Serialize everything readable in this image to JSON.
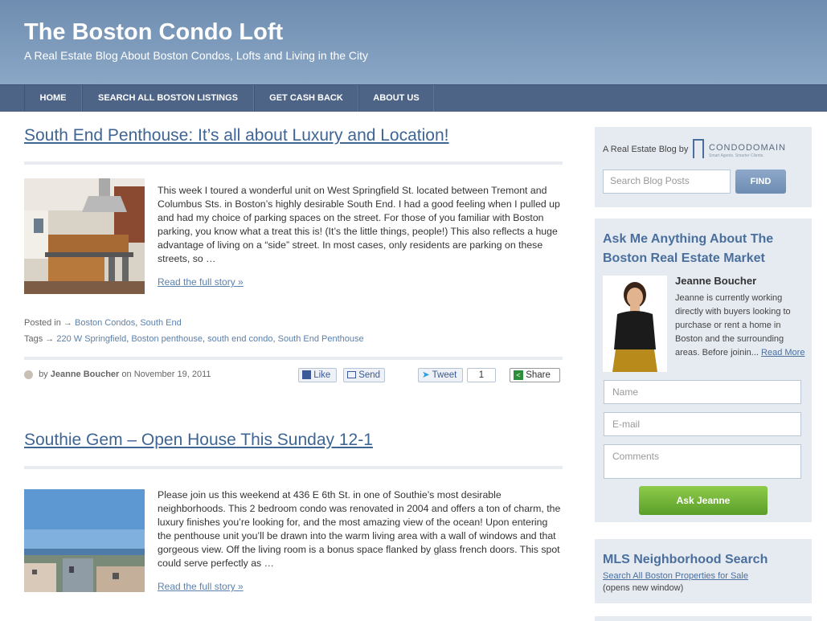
{
  "site": {
    "title": "The Boston Condo Loft",
    "tagline": "A Real Estate Blog About Boston Condos, Lofts and Living in the City"
  },
  "nav": [
    "HOME",
    "SEARCH ALL BOSTON LISTINGS",
    "GET CASH BACK",
    "ABOUT US"
  ],
  "post1": {
    "title": "South End Penthouse: It’s all about Luxury and Location!",
    "excerpt": "This week I toured a wonderful unit on West Springfield St. located between Tremont and Columbus Sts. in Boston’s highly desirable South End. I had a good feeling when I pulled up and had my choice of parking spaces on the street. For those of you familiar with Boston parking, you know what a treat this is! (It’s the little things, people!) This also reflects a huge advantage of living on a “side” street. In most cases, only residents are parking on these streets, so …",
    "read_more": "Read the full story »",
    "posted_in_label": "Posted in →",
    "categories": [
      "Boston Condos",
      "South End"
    ],
    "tags_label": "Tags →",
    "tags": [
      "220 W Springfield",
      "Boston penthouse",
      "south end condo",
      "South End Penthouse"
    ],
    "by_label": "by",
    "author": "Jeanne Boucher",
    "date_prefix": "on",
    "date": "November 19, 2011",
    "like": "Like",
    "send": "Send",
    "tweet": "Tweet",
    "tweet_count": "1",
    "share": "Share"
  },
  "post2": {
    "title": "Southie Gem – Open House This Sunday 12-1",
    "excerpt": "Please join us this weekend at 436 E 6th St. in one of Southie’s most desirable neighborhoods. This 2 bedroom condo was renovated in 2004 and offers a ton of charm, the luxury finishes you’re looking for, and the most amazing view of the ocean! Upon entering the penthouse unit you’ll be drawn into the warm living area with a wall of windows and that gorgeous view. Off the living room is a bonus space flanked by glass french doors. This spot could serve perfectly as …",
    "read_more": "Read the full story »"
  },
  "sidebar": {
    "blog_by": "A Real Estate Blog by",
    "brand": "CONDODOMAIN",
    "brand_sub": "Smart Agents. Smarter Clients.",
    "search_placeholder": "Search Blog Posts",
    "find": "FIND",
    "ask_heading": "Ask Me Anything About The Boston Real Estate Market",
    "agent_name": "Jeanne Boucher",
    "agent_bio": "Jeanne is currently working directly with buyers looking to purchase or rent a home in Boston and the surrounding areas. Before joinin...",
    "agent_read_more": "Read More",
    "name_placeholder": "Name",
    "email_placeholder": "E-mail",
    "comments_placeholder": "Comments",
    "ask_button": "Ask Jeanne",
    "mls_heading": "MLS Neighborhood Search",
    "mls_link": "Search All Boston Properties for Sale",
    "mls_note": "(opens new window)"
  }
}
